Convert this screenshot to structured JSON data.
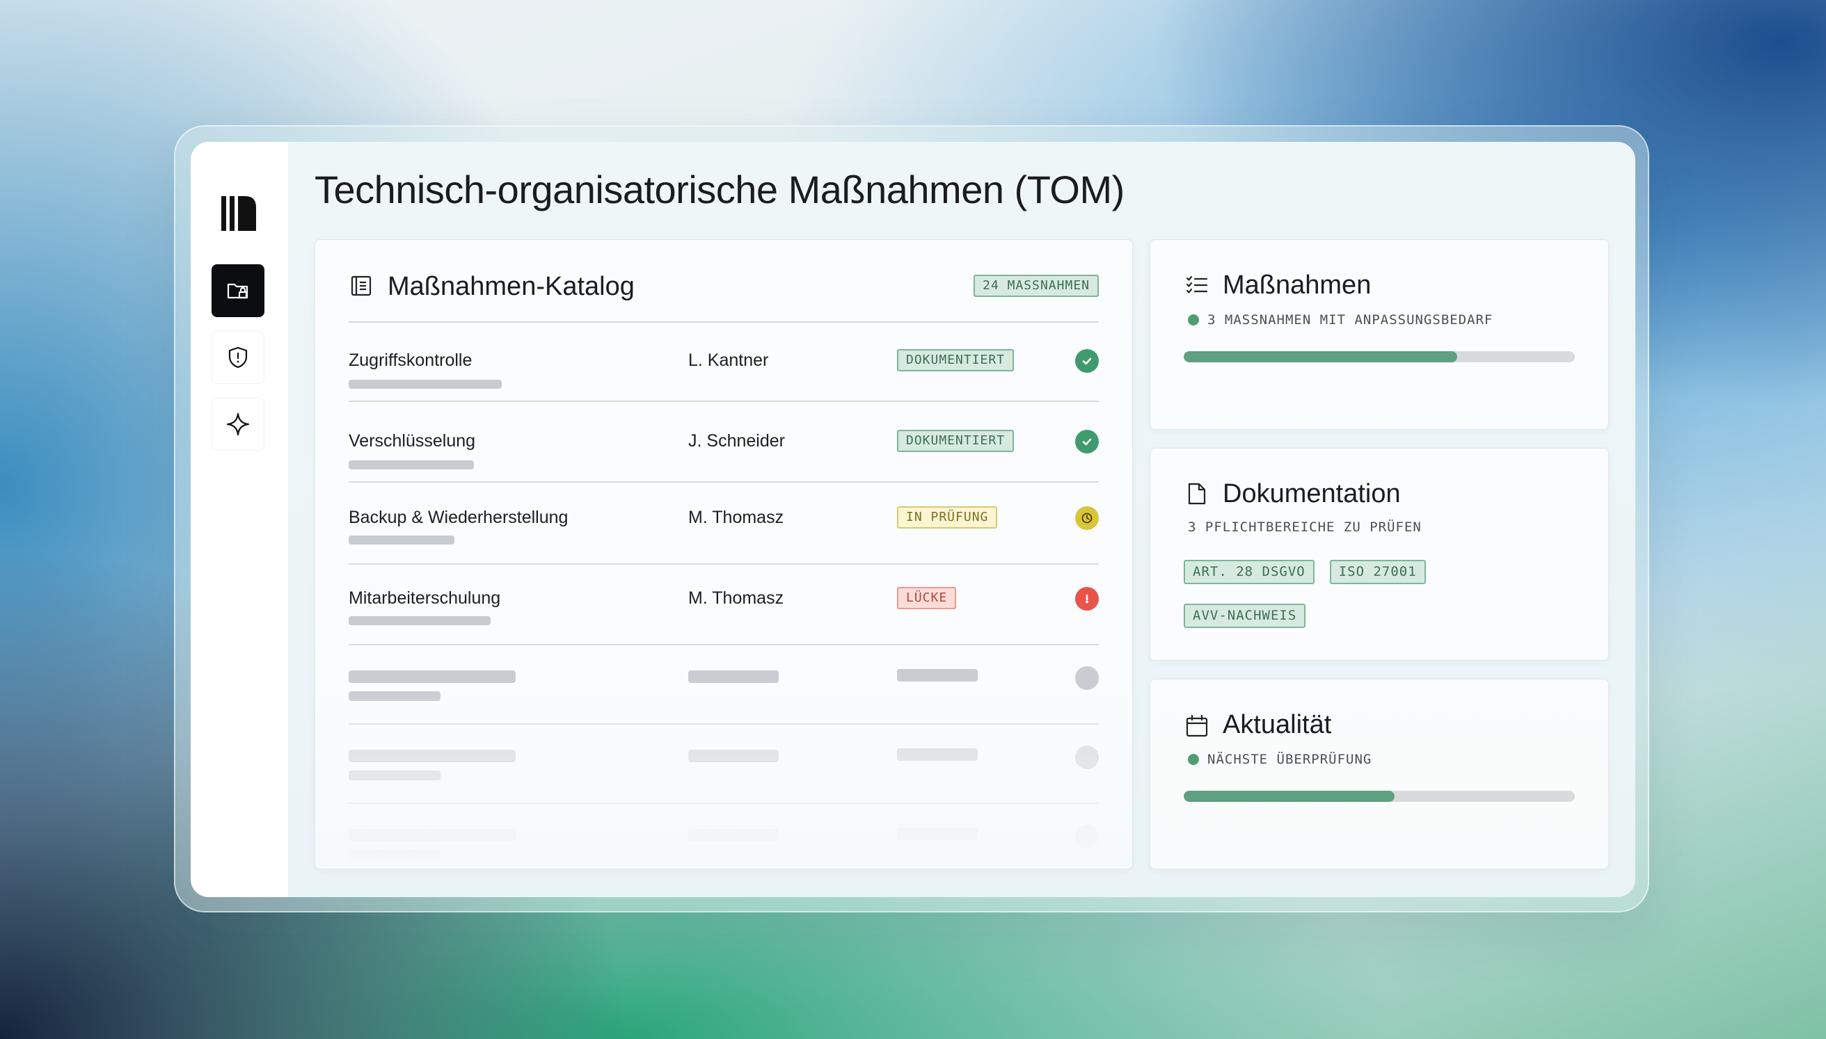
{
  "page": {
    "title": "Technisch-organisatorische Maßnahmen (TOM)"
  },
  "sidebar": {
    "items": [
      {
        "name": "folder-lock",
        "active": true
      },
      {
        "name": "shield-alert",
        "active": false
      },
      {
        "name": "sparkle",
        "active": false
      }
    ]
  },
  "catalog": {
    "title": "Maßnahmen-Katalog",
    "count_label": "24 MASSNAHMEN",
    "rows": [
      {
        "name": "Zugriffskontrolle",
        "owner": "L. Kantner",
        "status": "DOKUMENTIERT",
        "state": "done"
      },
      {
        "name": "Verschlüsselung",
        "owner": "J. Schneider",
        "status": "DOKUMENTIERT",
        "state": "done"
      },
      {
        "name": "Backup & Wiederherstellung",
        "owner": "M. Thomasz",
        "status": "IN PRÜFUNG",
        "state": "pending"
      },
      {
        "name": "Mitarbeiterschulung",
        "owner": "M. Thomasz",
        "status": "LÜCKE",
        "state": "gap"
      }
    ]
  },
  "measures_card": {
    "title": "Maßnahmen",
    "subtitle": "3 MASSNAHMEN MIT ANPASSUNGSBEDARF",
    "progress": 0.7
  },
  "documentation_card": {
    "title": "Dokumentation",
    "subtitle": "3 PFLICHTBEREICHE ZU PRÜFEN",
    "tags": [
      "ART. 28 DSGVO",
      "ISO 27001",
      "AVV-NACHWEIS"
    ]
  },
  "currency_card": {
    "title": "Aktualität",
    "subtitle": "NÄCHSTE ÜBERPRÜFUNG",
    "progress": 0.54
  },
  "colors": {
    "accent_green": "#5ea07f",
    "status_done": "#3f9b6e",
    "status_pending": "#d9c53a",
    "status_gap": "#e8544a",
    "sidebar_active": "#0c0d10"
  }
}
